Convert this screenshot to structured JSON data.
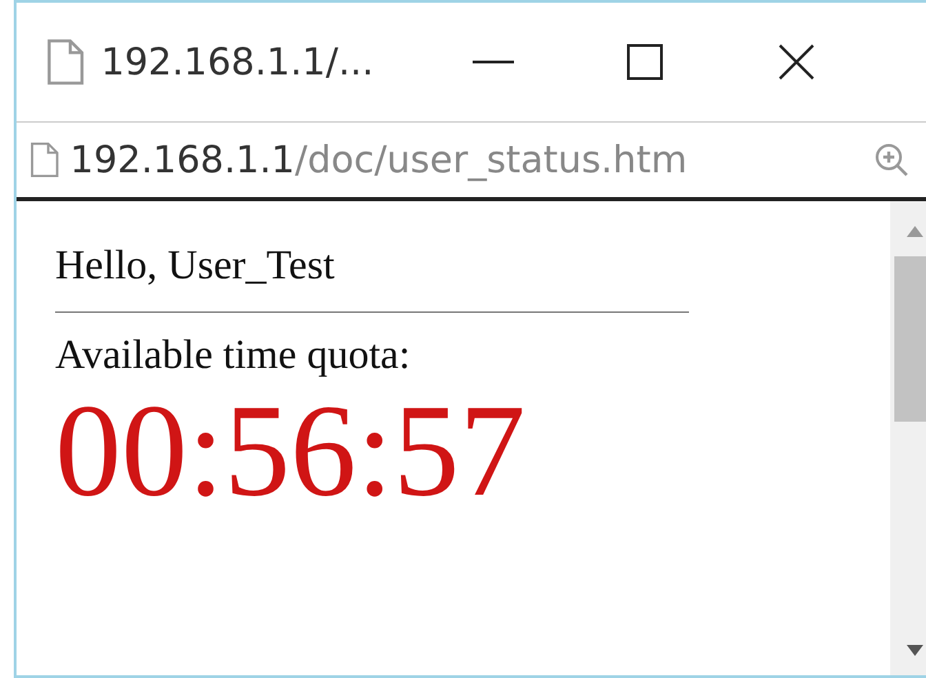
{
  "window": {
    "title": "192.168.1.1/..."
  },
  "address_bar": {
    "host": "192.168.1.1",
    "path": "/doc/user_status.htm"
  },
  "page": {
    "greeting": "Hello, User_Test",
    "quota_label": "Available time quota:",
    "quota_time": "00:56:57"
  }
}
